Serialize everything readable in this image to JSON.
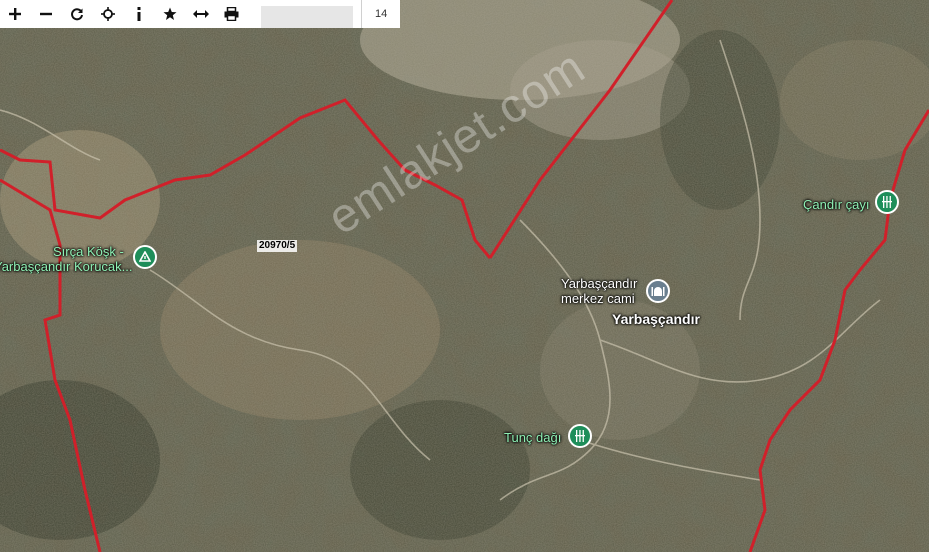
{
  "toolbar": {
    "buttons": [
      {
        "name": "zoom-in-icon"
      },
      {
        "name": "zoom-out-icon"
      },
      {
        "name": "refresh-icon"
      },
      {
        "name": "crosshair-icon"
      },
      {
        "name": "info-icon"
      },
      {
        "name": "star-icon"
      },
      {
        "name": "measure-icon"
      },
      {
        "name": "print-icon"
      }
    ],
    "zoom_level": "14"
  },
  "map": {
    "places": {
      "sirca": "Sırça Köşk -",
      "yarbascandir_korucak": "Yarbaşçandır Korucak...",
      "mosque_line1": "Yarbaşçandır",
      "mosque_line2": "merkez cami",
      "village": "Yarbaşçandır",
      "tunc": "Tunç dağı",
      "candir": "Çandır çayı"
    },
    "parcel": "20970/5",
    "watermark": "emlakjet.com",
    "boundary_color": "#d0202a",
    "poi_color": "#1e8e5a"
  }
}
